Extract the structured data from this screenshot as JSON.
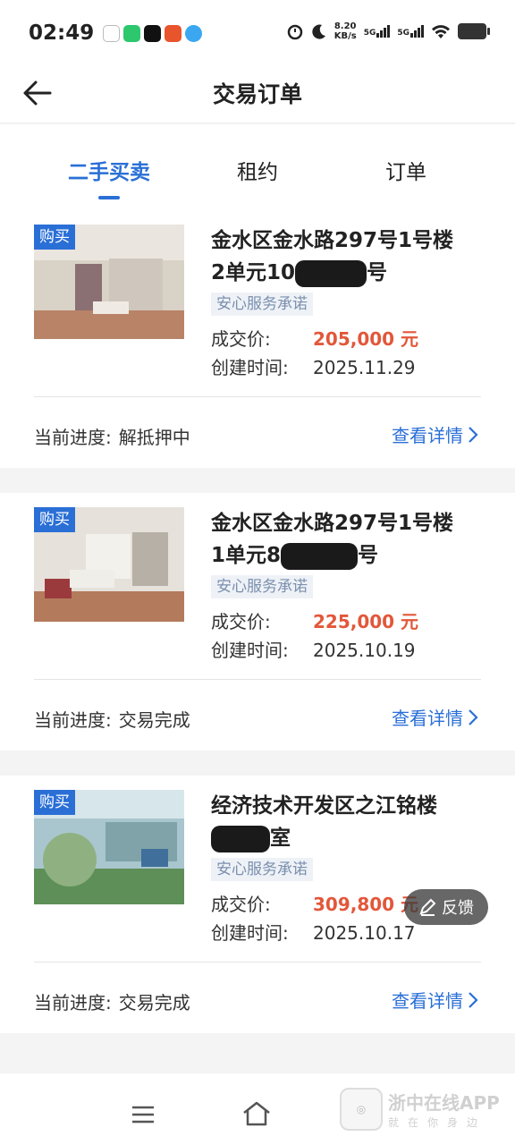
{
  "status_bar": {
    "time": "02:49",
    "net_speed_value": "8.20",
    "net_speed_unit": "KB/s",
    "signal1": "5G",
    "signal2": "5G"
  },
  "header": {
    "title": "交易订单"
  },
  "tabs": [
    {
      "label": "二手买卖",
      "active": true
    },
    {
      "label": "租约",
      "active": false
    },
    {
      "label": "订单",
      "active": false
    }
  ],
  "orders": [
    {
      "badge": "购买",
      "address_line1": "金水区金水路297号1号楼",
      "address_line2_pre": "2单元10",
      "address_line2_post": "号",
      "tag": "安心服务承诺",
      "price_label": "成交价:",
      "price": "205,000 元",
      "date_label": "创建时间:",
      "date": "2025.11.29",
      "progress_label": "当前进度:",
      "progress": "解抵押中",
      "detail": "查看详情"
    },
    {
      "badge": "购买",
      "address_line1": "金水区金水路297号1号楼",
      "address_line2_pre": "1单元8",
      "address_line2_post": "号",
      "tag": "安心服务承诺",
      "price_label": "成交价:",
      "price": "225,000 元",
      "date_label": "创建时间:",
      "date": "2025.10.19",
      "progress_label": "当前进度:",
      "progress": "交易完成",
      "detail": "查看详情"
    },
    {
      "badge": "购买",
      "address_line1": "经济技术开发区之江铭楼",
      "address_line2_pre": "",
      "address_line2_post": "室",
      "tag": "安心服务承诺",
      "price_label": "成交价:",
      "price": "309,800 元",
      "date_label": "创建时间:",
      "date": "2025.10.17",
      "progress_label": "当前进度:",
      "progress": "交易完成",
      "detail": "查看详情"
    }
  ],
  "feedback": {
    "label": "反馈"
  },
  "watermark": {
    "main": "浙中在线APP",
    "sub": "就在你身边"
  },
  "colors": {
    "accent": "#2a6fd6",
    "price": "#e2573a",
    "tag_bg": "#eef2f7"
  }
}
